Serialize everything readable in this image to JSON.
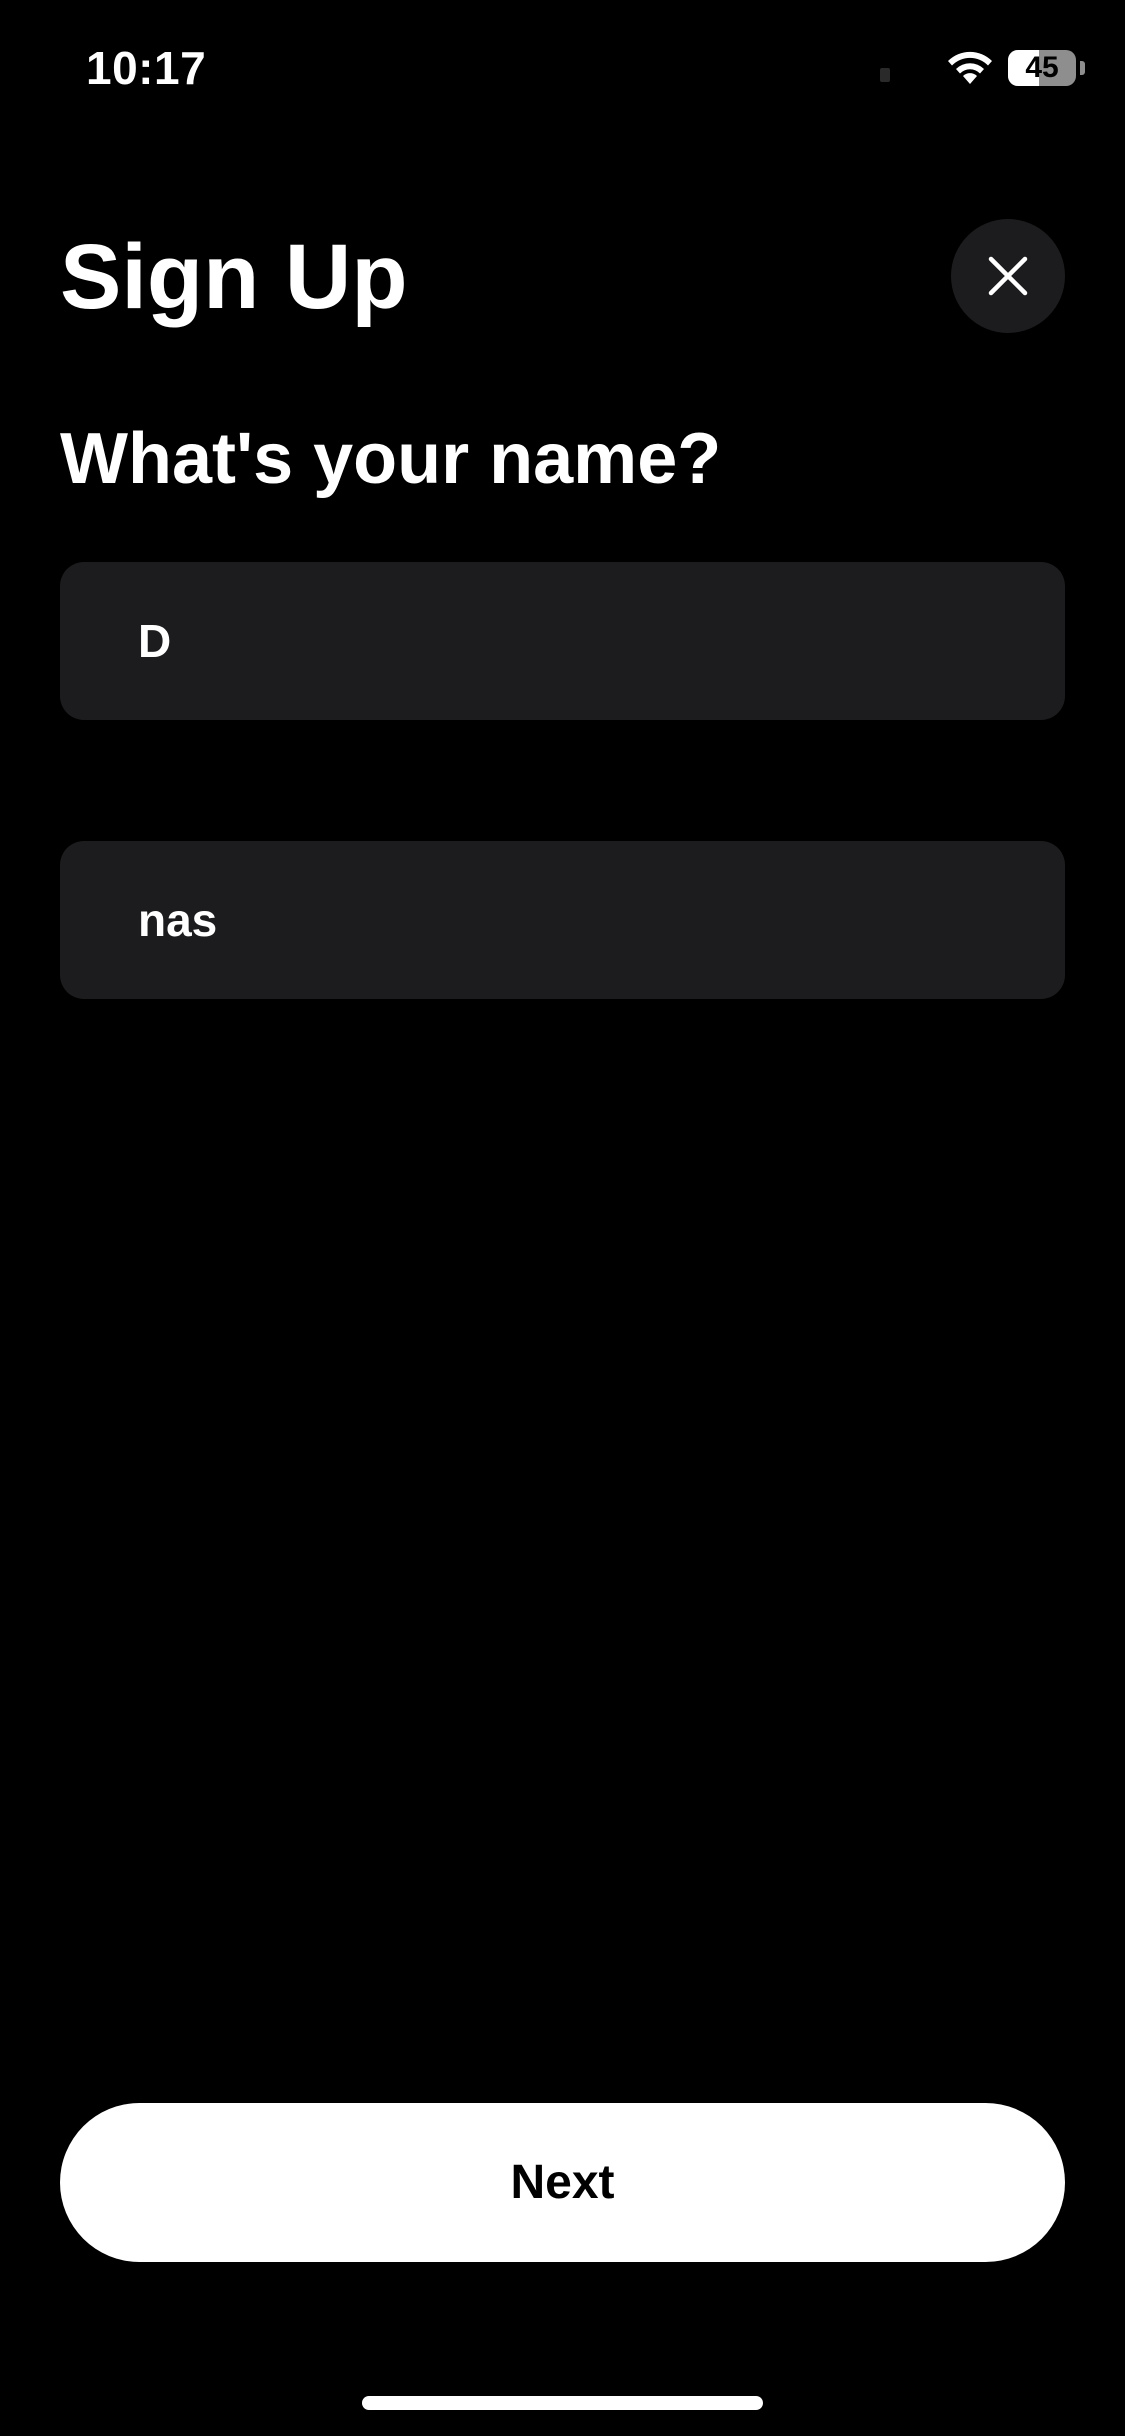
{
  "status_bar": {
    "time": "10:17",
    "battery_level": "45",
    "battery_fraction": 0.45,
    "wifi_icon": "wifi-icon"
  },
  "header": {
    "title": "Sign Up",
    "close_icon": "close-icon"
  },
  "form": {
    "question": "What's your name?",
    "first_name_value": "D",
    "last_name_value": "nas"
  },
  "footer": {
    "next_label": "Next"
  },
  "colors": {
    "background": "#000000",
    "field_background": "#1c1c1e",
    "primary_button": "#ffffff",
    "text": "#ffffff"
  }
}
